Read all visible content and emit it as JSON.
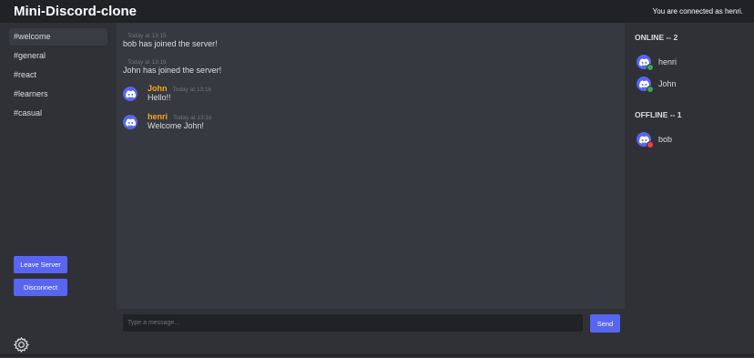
{
  "header": {
    "title": "Mini-Discord-clone",
    "status": "You are connected as henri."
  },
  "sidebar": {
    "channels": [
      {
        "label": "#welcome"
      },
      {
        "label": "#general"
      },
      {
        "label": "#react"
      },
      {
        "label": "#learners"
      },
      {
        "label": "#casual"
      }
    ],
    "active_channel": "#welcome",
    "leave_label": "Leave Server",
    "disconnect_label": "Disconnect",
    "settings_icon": "gear-icon"
  },
  "messages": {
    "system": [
      {
        "time": "Today at 13:15",
        "text": "bob has joined the server!"
      },
      {
        "time": "Today at 13:16",
        "text": "John has joined the server!"
      }
    ],
    "user": [
      {
        "author": "John",
        "time": "Today at 13:16",
        "text": "Hello!!"
      },
      {
        "author": "henri",
        "time": "Today at 13:16",
        "text": "Welcome John!"
      }
    ]
  },
  "composer": {
    "placeholder": "Type a message...",
    "send_label": "Send"
  },
  "members": {
    "online_title": "ONLINE -- 2",
    "online": [
      {
        "name": "henri",
        "status": "online"
      },
      {
        "name": "John",
        "status": "online"
      }
    ],
    "offline_title": "OFFLINE -- 1",
    "offline": [
      {
        "name": "bob",
        "status": "offline"
      }
    ]
  },
  "colors": {
    "accent": "#5865f2",
    "author": "#faa61a",
    "online": "#3ba55d",
    "offline": "#ed4245"
  }
}
